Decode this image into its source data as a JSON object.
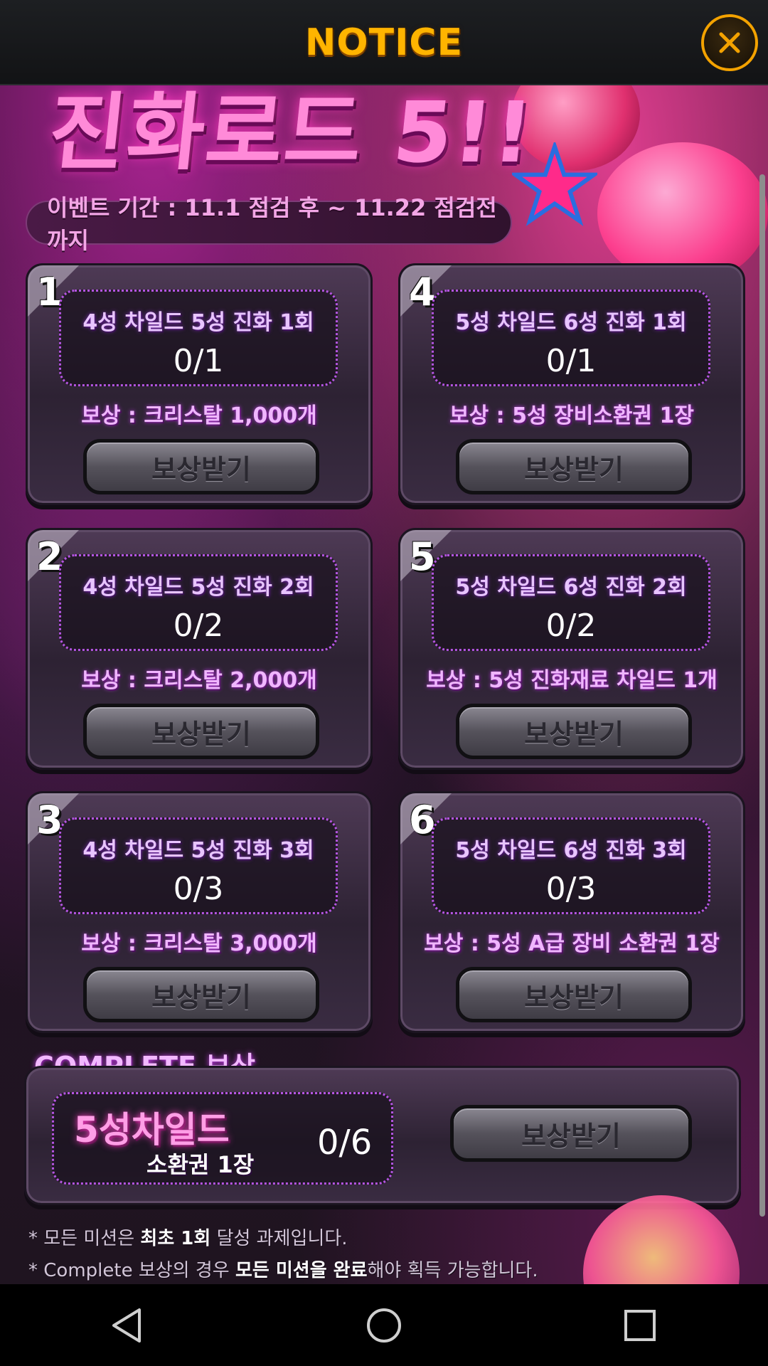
{
  "header": {
    "title": "NOTICE"
  },
  "banner": {
    "title": "진화로드 5!!",
    "period": "이벤트 기간 : 11.1 점검 후 ~ 11.22 점검전까지"
  },
  "missions": [
    {
      "num": "1",
      "title": "4성 차일드 5성 진화 1회",
      "progress": "0/1",
      "reward": "보상 : 크리스탈 1,000개",
      "button": "보상받기"
    },
    {
      "num": "2",
      "title": "4성 차일드 5성 진화 2회",
      "progress": "0/2",
      "reward": "보상 : 크리스탈 2,000개",
      "button": "보상받기"
    },
    {
      "num": "3",
      "title": "4성 차일드 5성 진화 3회",
      "progress": "0/3",
      "reward": "보상 : 크리스탈 3,000개",
      "button": "보상받기"
    },
    {
      "num": "4",
      "title": "5성 차일드 6성 진화 1회",
      "progress": "0/1",
      "reward": "보상 : 5성 장비소환권 1장",
      "button": "보상받기"
    },
    {
      "num": "5",
      "title": "5성 차일드 6성 진화 2회",
      "progress": "0/2",
      "reward": "보상 : 5성 진화재료 차일드 1개",
      "button": "보상받기"
    },
    {
      "num": "6",
      "title": "5성 차일드 6성 진화 3회",
      "progress": "0/3",
      "reward": "보상 : 5성 A급 장비 소환권 1장",
      "button": "보상받기"
    }
  ],
  "complete": {
    "label": "COMPLETE 보상",
    "reward_main": "5성차일드",
    "reward_sub": "소환권 1장",
    "progress": "0/6",
    "button": "보상받기"
  },
  "notes": [
    {
      "prefix": "* 모든 미션은 ",
      "bold": "최초 1회",
      "suffix": " 달성 과제입니다."
    },
    {
      "prefix": "* Complete 보상의 경우 ",
      "bold": "모든 미션을 완료",
      "suffix": "해야 획득 가능합니다."
    }
  ],
  "colors": {
    "accent": "#ffb400",
    "purple": "#b555e2",
    "pink": "#ff8ad8"
  }
}
